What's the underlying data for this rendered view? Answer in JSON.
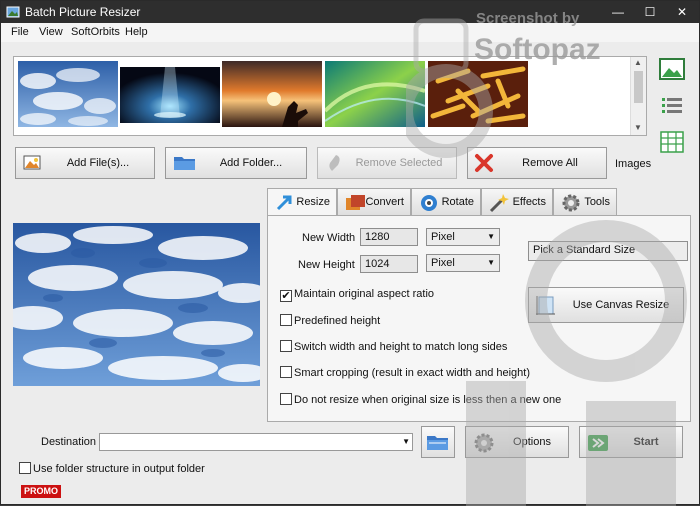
{
  "window": {
    "title": "Batch Picture Resizer",
    "minimize": "—",
    "maximize": "☐",
    "close": "✕"
  },
  "menu": [
    "File",
    "View",
    "SoftOrbits",
    "Help"
  ],
  "thumbnails": [
    "sky-clouds-thumbnail",
    "light-rays-thumbnail",
    "sunset-hand-thumbnail",
    "green-abstract-thumbnail",
    "fries-thumbnail"
  ],
  "actions": {
    "add_files": "Add File(s)...",
    "add_folder": "Add Folder...",
    "remove_selected": "Remove Selected",
    "remove_all": "Remove All",
    "images_label": "Images"
  },
  "tabs": [
    "Resize",
    "Convert",
    "Rotate",
    "Effects",
    "Tools"
  ],
  "resize": {
    "width_label": "New Width",
    "width_value": "1280",
    "width_unit": "Pixel",
    "height_label": "New Height",
    "height_value": "1024",
    "height_unit": "Pixel",
    "standard_size": "Pick a Standard Size",
    "canvas_resize": "Use Canvas Resize",
    "options": [
      {
        "label": "Maintain original aspect ratio",
        "checked": true
      },
      {
        "label": "Predefined height",
        "checked": false
      },
      {
        "label": "Switch width and height to match long sides",
        "checked": false
      },
      {
        "label": "Smart cropping (result in exact width and height)",
        "checked": false
      },
      {
        "label": "Do not resize when original size is less then a new one",
        "checked": false
      }
    ]
  },
  "footer": {
    "destination_label": "Destination",
    "destination_value": "",
    "options_button": "Options",
    "start_button": "Start",
    "folder_structure": "Use folder structure in output folder",
    "promo": "PROMO"
  },
  "watermark": {
    "line1": "Screenshot by",
    "line2": "Softopaz"
  },
  "colors": {
    "accent_blue": "#3b78c7",
    "start_green": "#3aa14a",
    "remove_red": "#d9362b",
    "promo_red": "#c11111"
  }
}
